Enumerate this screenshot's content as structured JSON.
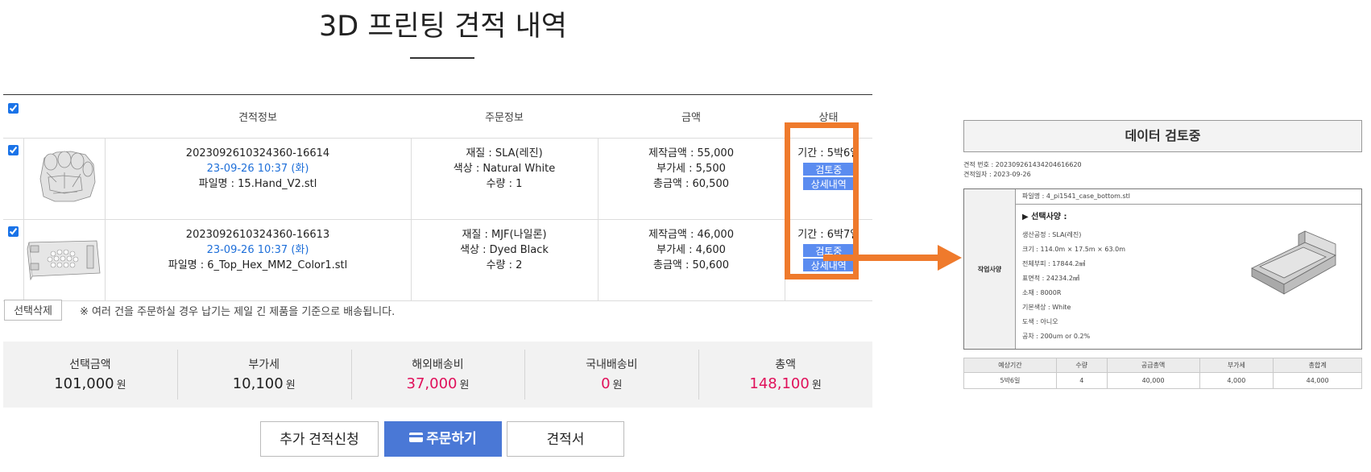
{
  "page": {
    "title": "3D 프린팅 견적 내역"
  },
  "table": {
    "headers": [
      "견적정보",
      "주문정보",
      "금액",
      "상태"
    ],
    "rows": [
      {
        "quote_no": "2023092610324360-16614",
        "date": "23-09-26 10:37 (화)",
        "file": "파일명 : 15.Hand_V2.stl",
        "material": "재질 : SLA(레진)",
        "color": "색상 : Natural White",
        "qty": "수량 : 1",
        "prod_price": "제작금액 : 55,000",
        "vat": "부가세 : 5,500",
        "total": "총금액 : 60,500",
        "period": "기간 : 5박6일",
        "status_btn": "검토중",
        "detail_btn": "상세내역"
      },
      {
        "quote_no": "2023092610324360-16613",
        "date": "23-09-26 10:37 (화)",
        "file": "파일명 : 6_Top_Hex_MM2_Color1.stl",
        "material": "재질 : MJF(나일론)",
        "color": "색상 : Dyed Black",
        "qty": "수량 : 2",
        "prod_price": "제작금액 : 46,000",
        "vat": "부가세 : 4,600",
        "total": "총금액 : 50,600",
        "period": "기간 : 6박7일",
        "status_btn": "검토중",
        "detail_btn": "상세내역"
      }
    ]
  },
  "actions": {
    "delete_selected": "선택삭제",
    "note": "※ 여러 건을 주문하실 경우 납기는 제일 긴 제품을 기준으로 배송됩니다."
  },
  "summary": [
    {
      "label": "선택금액",
      "value": "101,000",
      "unit": "원"
    },
    {
      "label": "부가세",
      "value": "10,100",
      "unit": "원"
    },
    {
      "label": "해외배송비",
      "value": "37,000",
      "unit": "원"
    },
    {
      "label": "국내배송비",
      "value": "0",
      "unit": "원"
    },
    {
      "label": "총액",
      "value": "148,100",
      "unit": "원"
    }
  ],
  "buttons": {
    "add_quote": "추가 견적신청",
    "order": "주문하기",
    "quote_doc": "견적서"
  },
  "detail_panel": {
    "title": "데이터 검토중",
    "quote_no": "견적 번호 : 20230926143420461662‌0",
    "quote_date": "견적일자 : 2023-09-26",
    "side_label": "작업사양",
    "file": "파일명 : 4_pi1541_case_bottom.stl",
    "spec_head": "▶ 선택사양 :",
    "specs": [
      "생산공정 : SLA(레진)",
      "크기 : 114.0m × 17.5m × 63.0m",
      "전체부피 : 17844.2㎣",
      "표면적 : 24234.2㎟",
      "소재 : 8000R",
      "기본색상 : White",
      "도색 : 아니오",
      "공차 : 200um or 0.2%"
    ],
    "price_headers": [
      "예상기간",
      "수량",
      "공급총액",
      "부가세",
      "총합계"
    ],
    "price_row": [
      "5박6일",
      "4",
      "40,000",
      "4,000",
      "44,000"
    ]
  },
  "colors": {
    "accent_blue": "#4a78d6",
    "highlight_orange": "#ef7a2c",
    "price_red": "#e0105a"
  }
}
